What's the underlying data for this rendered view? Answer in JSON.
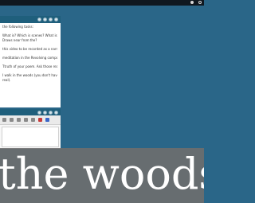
{
  "questions": [
    "the following tasks:",
    "What is? Which is scenes? What is happening?",
    "Draws near from the?",
    "this video to be recorded as a narration Your",
    "meditation in the Revolving component",
    "Ttruth of your poem. Ask those really",
    "I walk in the woods (you don't have to use your",
    "real)."
  ],
  "caption": "the woods",
  "colors": {
    "desktop": "#2a6688",
    "header": "#1f5f7c",
    "overlay": "#6e6e6e"
  }
}
